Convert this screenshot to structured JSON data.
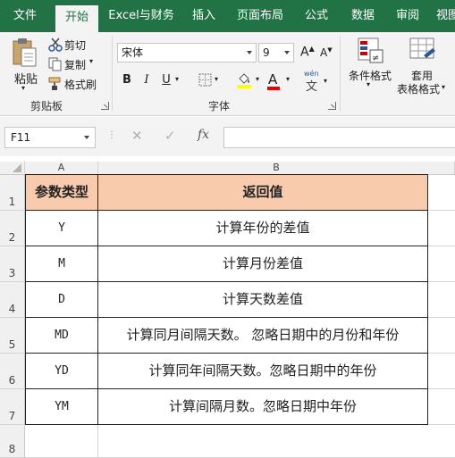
{
  "ribbon_tabs": [
    "文件",
    "开始",
    "Excel与财务",
    "插入",
    "页面布局",
    "公式",
    "数据",
    "审阅",
    "视图"
  ],
  "clipboard": {
    "paste_label": "粘贴",
    "cut_label": "剪切",
    "copy_label": "复制",
    "format_painter_label": "格式刷",
    "group_label": "剪贴板"
  },
  "font_group": {
    "font_name": "宋体",
    "font_size": "9",
    "bold": "B",
    "italic": "I",
    "underline": "U",
    "group_label": "字体",
    "grow_font": "A",
    "shrink_font": "A",
    "pinyin": "wén"
  },
  "styles_group": {
    "conditional_format_label": "条件格式",
    "table_format_label_1": "套用",
    "table_format_label_2": "表格格式"
  },
  "formula_bar": {
    "name_box": "F11",
    "cancel": "✕",
    "enter": "✓",
    "fx": "fx",
    "value": ""
  },
  "columns": [
    "A",
    "B"
  ],
  "rows": [
    "1",
    "2",
    "3",
    "4",
    "5",
    "6",
    "7",
    "8"
  ],
  "table": {
    "header": {
      "type": "参数类型",
      "return": "返回值"
    },
    "rows": [
      {
        "code": "Y",
        "desc": "计算年份的差值"
      },
      {
        "code": "M",
        "desc": "计算月份差值"
      },
      {
        "code": "D",
        "desc": "计算天数差值"
      },
      {
        "code": "MD",
        "desc": "计算同月间隔天数。 忽略日期中的月份和年份"
      },
      {
        "code": "YD",
        "desc": "计算同年间隔天数。忽略日期中的年份"
      },
      {
        "code": "YM",
        "desc": "计算间隔月数。忽略日期中年份"
      }
    ]
  },
  "colors": {
    "ribbon_green": "#217346",
    "header_fill": "#F8CBAD"
  }
}
